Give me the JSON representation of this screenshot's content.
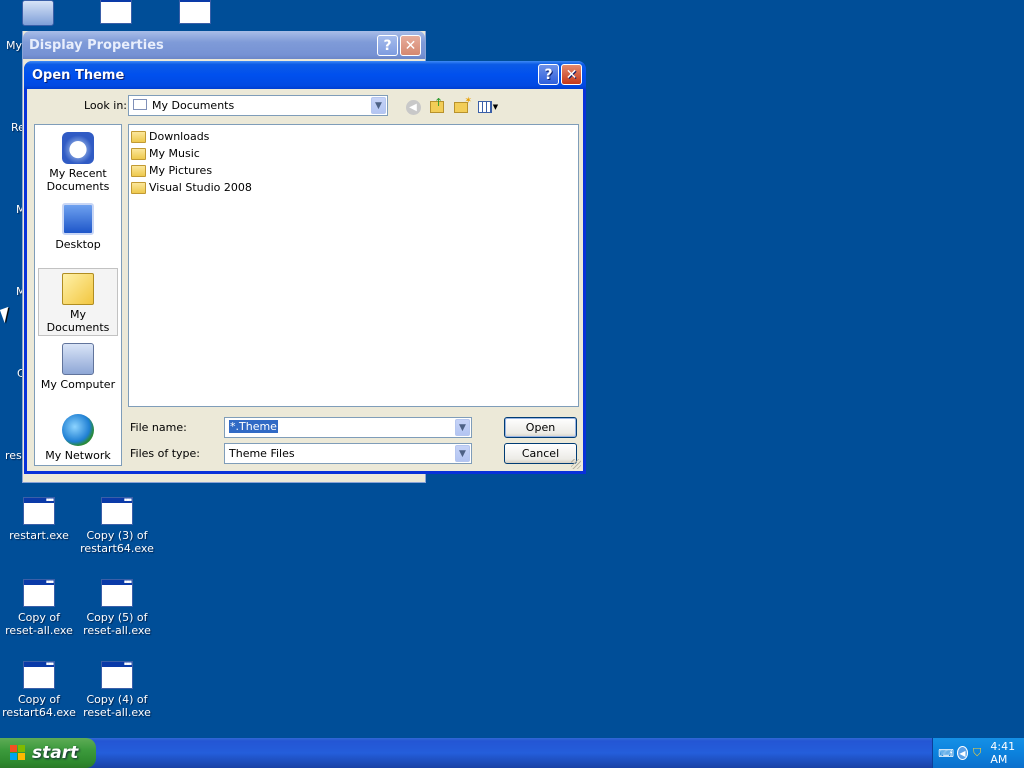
{
  "desktop": {
    "icons": [
      {
        "label": "restart.exe"
      },
      {
        "label": "Copy (3) of restart64.exe"
      },
      {
        "label": "Copy of reset-all.exe"
      },
      {
        "label": "Copy (5) of reset-all.exe"
      },
      {
        "label": "Copy of restart64.exe"
      },
      {
        "label": "Copy (4) of reset-all.exe"
      }
    ],
    "edge_labels": [
      "My",
      "Re",
      "M",
      "M",
      "C",
      "rest"
    ]
  },
  "display_properties": {
    "title": "Display Properties",
    "help": "?",
    "close": "✕"
  },
  "dialog": {
    "title": "Open Theme",
    "help": "?",
    "close": "✕",
    "look_in_label": "Look in:",
    "look_in_value": "My Documents",
    "places": [
      {
        "label": "My Recent Documents",
        "icon": "recent-documents-icon"
      },
      {
        "label": "Desktop",
        "icon": "desktop-icon"
      },
      {
        "label": "My Documents",
        "icon": "my-documents-icon",
        "selected": true
      },
      {
        "label": "My Computer",
        "icon": "my-computer-icon"
      },
      {
        "label": "My Network",
        "icon": "my-network-icon"
      }
    ],
    "files": [
      {
        "name": "Downloads"
      },
      {
        "name": "My Music"
      },
      {
        "name": "My Pictures"
      },
      {
        "name": "Visual Studio 2008"
      }
    ],
    "file_name_label": "File name:",
    "file_name_value": "*.Theme",
    "file_type_label": "Files of type:",
    "file_type_value": "Theme Files",
    "open_label": "Open",
    "cancel_label": "Cancel"
  },
  "taskbar": {
    "start_label": "start",
    "clock": "4:41 AM"
  }
}
